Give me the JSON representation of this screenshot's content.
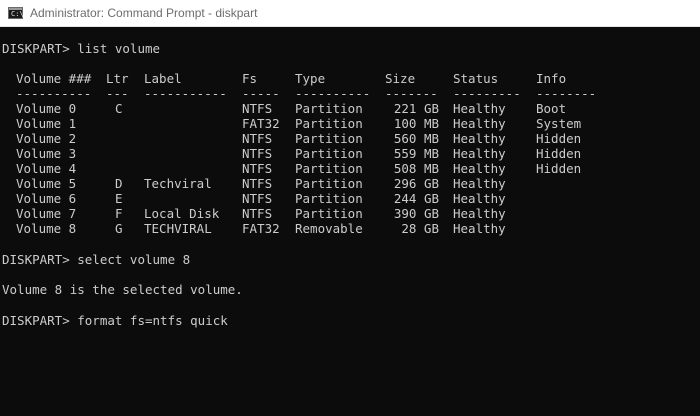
{
  "window": {
    "title": "Administrator: Command Prompt - diskpart",
    "icon": "command-prompt-icon"
  },
  "console": {
    "cmd1": "DISKPART> list volume",
    "headers": {
      "volume": "Volume ###",
      "ltr": "Ltr",
      "label": "Label",
      "fs": "Fs",
      "type": "Type",
      "size": "Size",
      "status": "Status",
      "info": "Info"
    },
    "dashes": {
      "volume": "----------",
      "ltr": "---",
      "label": "-----------",
      "fs": "-----",
      "type": "----------",
      "size": "-------",
      "status": "---------",
      "info": "--------"
    },
    "volumes": [
      {
        "volume": "Volume 0",
        "ltr": "C",
        "label": "",
        "fs": "NTFS",
        "type": "Partition",
        "size": "221 GB",
        "status": "Healthy",
        "info": "Boot"
      },
      {
        "volume": "Volume 1",
        "ltr": "",
        "label": "",
        "fs": "FAT32",
        "type": "Partition",
        "size": "100 MB",
        "status": "Healthy",
        "info": "System"
      },
      {
        "volume": "Volume 2",
        "ltr": "",
        "label": "",
        "fs": "NTFS",
        "type": "Partition",
        "size": "560 MB",
        "status": "Healthy",
        "info": "Hidden"
      },
      {
        "volume": "Volume 3",
        "ltr": "",
        "label": "",
        "fs": "NTFS",
        "type": "Partition",
        "size": "559 MB",
        "status": "Healthy",
        "info": "Hidden"
      },
      {
        "volume": "Volume 4",
        "ltr": "",
        "label": "",
        "fs": "NTFS",
        "type": "Partition",
        "size": "508 MB",
        "status": "Healthy",
        "info": "Hidden"
      },
      {
        "volume": "Volume 5",
        "ltr": "D",
        "label": "Techviral",
        "fs": "NTFS",
        "type": "Partition",
        "size": "296 GB",
        "status": "Healthy",
        "info": ""
      },
      {
        "volume": "Volume 6",
        "ltr": "E",
        "label": "",
        "fs": "NTFS",
        "type": "Partition",
        "size": "244 GB",
        "status": "Healthy",
        "info": ""
      },
      {
        "volume": "Volume 7",
        "ltr": "F",
        "label": "Local Disk",
        "fs": "NTFS",
        "type": "Partition",
        "size": "390 GB",
        "status": "Healthy",
        "info": ""
      },
      {
        "volume": "Volume 8",
        "ltr": "G",
        "label": "TECHVIRAL",
        "fs": "FAT32",
        "type": "Removable",
        "size": "28 GB",
        "status": "Healthy",
        "info": ""
      }
    ],
    "cmd2": "DISKPART> select volume 8",
    "message": "Volume 8 is the selected volume.",
    "cmd3": "DISKPART> format fs=ntfs quick"
  },
  "colors": {
    "background": "#0c0c0c",
    "text": "#cccccc",
    "titlebar": "#ffffff",
    "title_text": "#6d6d6d"
  }
}
